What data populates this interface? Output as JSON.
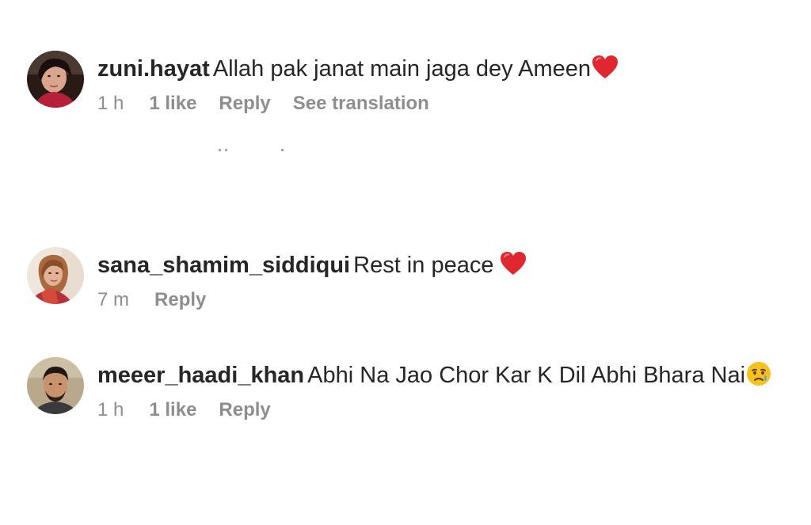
{
  "comments": [
    {
      "username": "zuni.hayat",
      "text": "Allah pak janat main jaga dey Ameen",
      "emoji": "red-heart-icon",
      "time": "1 h",
      "likes": "1 like",
      "reply": "Reply",
      "translate": "See translation"
    },
    {
      "username": "sana_shamim_siddiqui",
      "text": "Rest in peace",
      "emoji": "red-heart-icon",
      "time": "7 m",
      "reply": "Reply"
    },
    {
      "username": "meeer_haadi_khan",
      "text": "Abhi Na Jao Chor Kar K Dil Abhi Bhara Nai",
      "emoji": "crying-face-icon",
      "time": "1 h",
      "likes": "1 like",
      "reply": "Reply"
    }
  ],
  "colors": {
    "username": "#262626",
    "meta": "#8e8e8e",
    "heart": "#e0262f",
    "emoji_face": "#f7c21c",
    "tear": "#5aa8e6"
  }
}
